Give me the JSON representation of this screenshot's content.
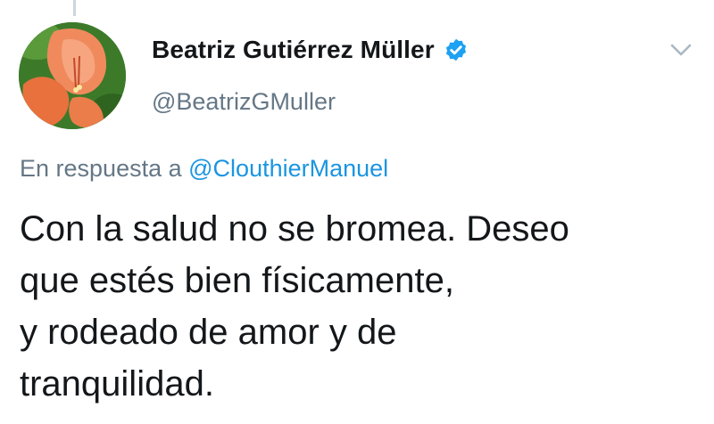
{
  "tweet": {
    "display_name": "Beatriz Gutiérrez Müller",
    "handle": "@BeatrizGMuller",
    "reply_prefix": "En respuesta a",
    "reply_mention": "@ClouthierManuel",
    "text_lines": [
      "Con la salud no se bromea. Deseo",
      "que estés bien físicamente,",
      "y rodeado de amor y de",
      "tranquilidad."
    ]
  },
  "icons": {
    "verified": "verified-badge-icon",
    "menu": "chevron-down-icon",
    "avatar": "flower-avatar"
  },
  "colors": {
    "verified_blue": "#1da1f2",
    "mention_blue": "#1b95e0",
    "secondary_text": "#657786",
    "primary_text": "#14171a"
  }
}
